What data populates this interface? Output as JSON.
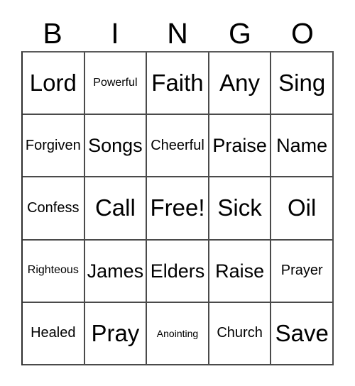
{
  "card": {
    "type": "bingo-card",
    "columns": 5,
    "rows": 5,
    "background_color": "#ffffff",
    "text_color": "#000000",
    "border_color": "#4a4a4a"
  },
  "header": {
    "letters": [
      {
        "label": "B"
      },
      {
        "label": "I"
      },
      {
        "label": "N"
      },
      {
        "label": "G"
      },
      {
        "label": "O"
      }
    ]
  },
  "grid": {
    "cells": [
      {
        "label": "Lord",
        "size": "size-xl"
      },
      {
        "label": "Powerful",
        "size": "size-xs"
      },
      {
        "label": "Faith",
        "size": "size-xl"
      },
      {
        "label": "Any",
        "size": "size-xl"
      },
      {
        "label": "Sing",
        "size": "size-xl"
      },
      {
        "label": "Forgiven",
        "size": "size-sm"
      },
      {
        "label": "Songs",
        "size": "size-md"
      },
      {
        "label": "Cheerful",
        "size": "size-sm"
      },
      {
        "label": "Praise",
        "size": "size-md"
      },
      {
        "label": "Name",
        "size": "size-md"
      },
      {
        "label": "Confess",
        "size": "size-sm"
      },
      {
        "label": "Call",
        "size": "size-xl"
      },
      {
        "label": "Free!",
        "size": "size-xl"
      },
      {
        "label": "Sick",
        "size": "size-xl"
      },
      {
        "label": "Oil",
        "size": "size-xl"
      },
      {
        "label": "Righteous",
        "size": "size-xs"
      },
      {
        "label": "James",
        "size": "size-md"
      },
      {
        "label": "Elders",
        "size": "size-md"
      },
      {
        "label": "Raise",
        "size": "size-md"
      },
      {
        "label": "Prayer",
        "size": "size-sm"
      },
      {
        "label": "Healed",
        "size": "size-sm"
      },
      {
        "label": "Pray",
        "size": "size-xl"
      },
      {
        "label": "Anointing",
        "size": "size-xxs"
      },
      {
        "label": "Church",
        "size": "size-sm"
      },
      {
        "label": "Save",
        "size": "size-xl"
      }
    ]
  }
}
